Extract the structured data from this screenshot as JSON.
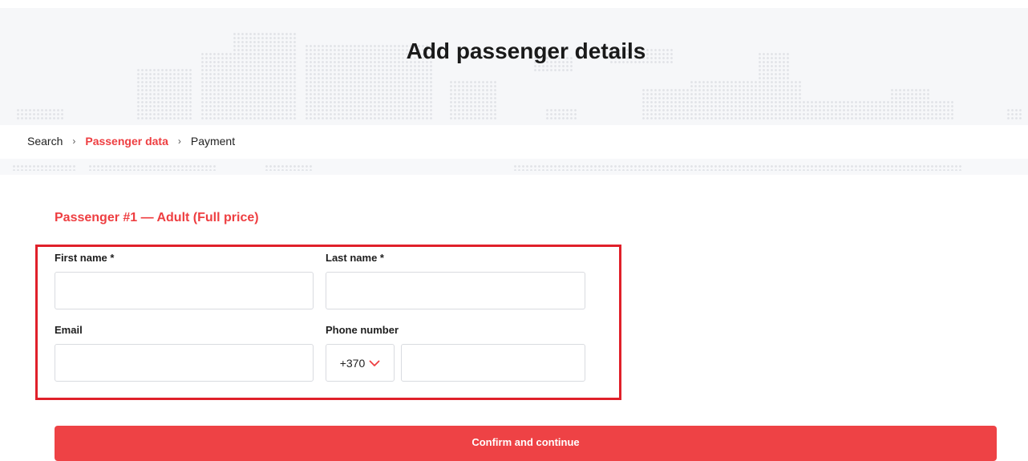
{
  "header": {
    "title": "Add passenger details"
  },
  "breadcrumb": {
    "items": [
      {
        "label": "Search",
        "active": false
      },
      {
        "label": "Passenger data",
        "active": true
      },
      {
        "label": "Payment",
        "active": false
      }
    ],
    "separator": "›"
  },
  "passenger": {
    "heading": "Passenger #1 — Adult (Full price)",
    "fields": {
      "first_name": {
        "label": "First name *",
        "value": "",
        "placeholder": ""
      },
      "last_name": {
        "label": "Last name *",
        "value": "",
        "placeholder": ""
      },
      "email": {
        "label": "Email",
        "value": "",
        "placeholder": ""
      },
      "phone": {
        "label": "Phone number",
        "country_code": "+370",
        "value": "",
        "placeholder": ""
      }
    }
  },
  "actions": {
    "confirm_label": "Confirm and continue"
  },
  "icons": {
    "breadcrumb_separator": "chevron-right-icon",
    "country_code_toggle": "chevron-down-icon"
  },
  "colors": {
    "accent": "#ee4245",
    "highlight_frame": "#e0202a",
    "hero_background": "#f6f7f9"
  }
}
